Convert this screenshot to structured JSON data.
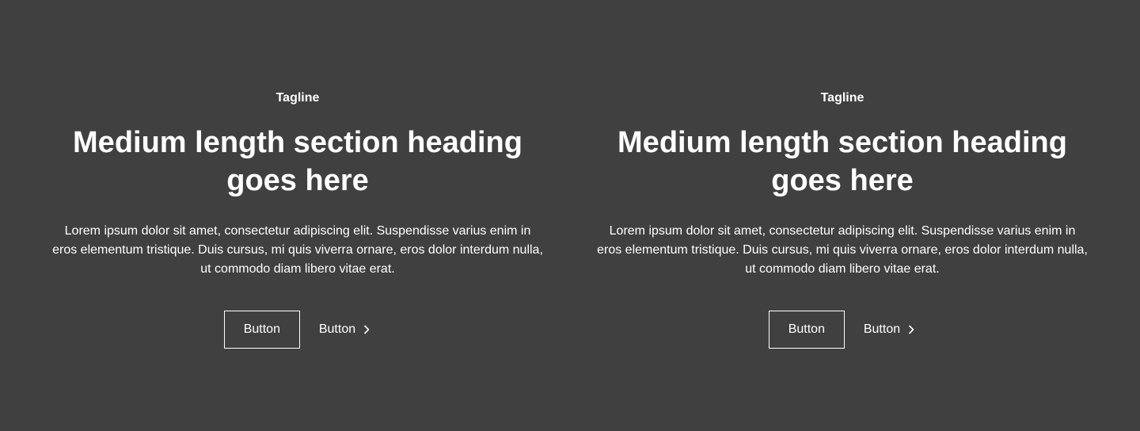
{
  "colors": {
    "background": "#404040",
    "text": "#ffffff"
  },
  "sections": [
    {
      "tagline": "Tagline",
      "heading": "Medium length section heading goes here",
      "body": "Lorem ipsum dolor sit amet, consectetur adipiscing elit. Suspendisse varius enim in eros elementum tristique. Duis cursus, mi quis viverra ornare, eros dolor interdum nulla, ut commodo diam libero vitae erat.",
      "primary_button": "Button",
      "secondary_button": "Button",
      "secondary_icon": "chevron-right-icon"
    },
    {
      "tagline": "Tagline",
      "heading": "Medium length section heading goes here",
      "body": "Lorem ipsum dolor sit amet, consectetur adipiscing elit. Suspendisse varius enim in eros elementum tristique. Duis cursus, mi quis viverra ornare, eros dolor interdum nulla, ut commodo diam libero vitae erat.",
      "primary_button": "Button",
      "secondary_button": "Button",
      "secondary_icon": "chevron-right-icon"
    }
  ]
}
